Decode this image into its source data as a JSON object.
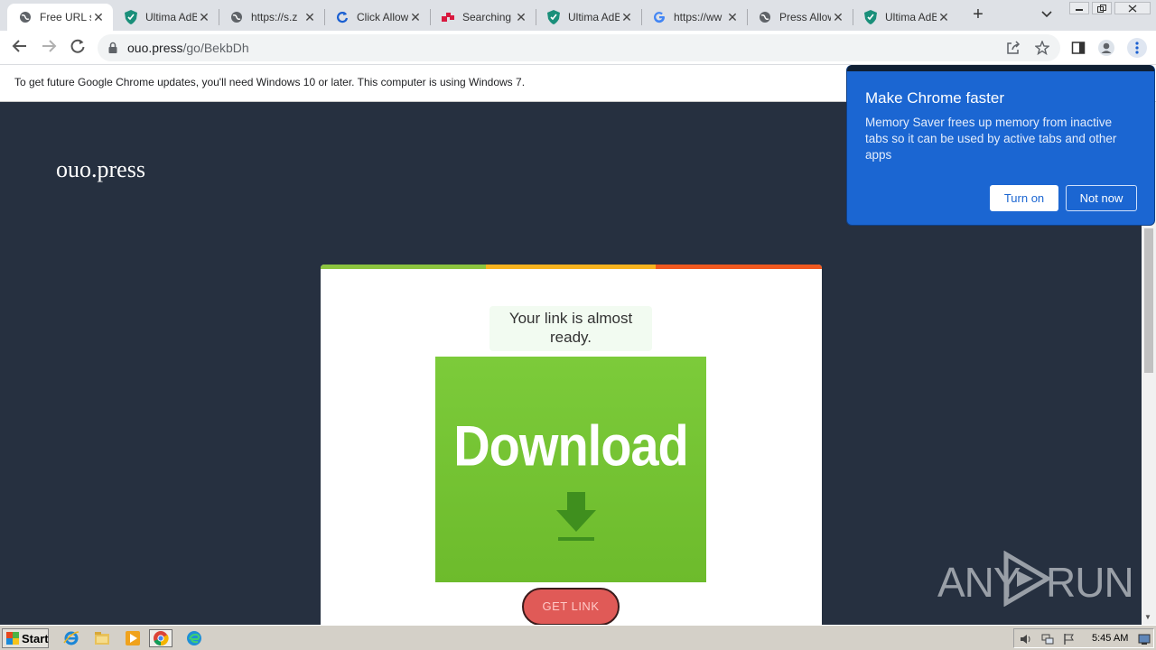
{
  "tabs": [
    {
      "title": "Free URL s",
      "icon": "globe-icon",
      "active": true
    },
    {
      "title": "Ultima AdBl",
      "icon": "shield-icon"
    },
    {
      "title": "https://s.z",
      "icon": "globe-icon"
    },
    {
      "title": "Click Allow",
      "icon": "refresh-icon"
    },
    {
      "title": "Searching f",
      "icon": "dots-icon"
    },
    {
      "title": "Ultima AdBl",
      "icon": "shield-icon"
    },
    {
      "title": "https://ww",
      "icon": "google-icon"
    },
    {
      "title": "Press Allow",
      "icon": "globe-icon"
    },
    {
      "title": "Ultima AdBl",
      "icon": "shield-icon"
    }
  ],
  "toolbar": {
    "url_host": "ouo.press",
    "url_path": "/go/BekbDh"
  },
  "infobar": {
    "message": "To get future Google Chrome updates, you'll need Windows 10 or later. This computer is using Windows 7."
  },
  "page": {
    "logo": "ouo.press",
    "ready_text": "Your link is almost ready.",
    "download_text": "Download",
    "get_link_label": "GET LINK",
    "stripe_colors": [
      "#8cc43f",
      "#f7b31e",
      "#f0581f"
    ]
  },
  "popup": {
    "title": "Make Chrome faster",
    "body": "Memory Saver frees up memory from inactive tabs so it can be used by active tabs and other apps",
    "turn_on_label": "Turn on",
    "not_now_label": "Not now"
  },
  "watermark": {
    "left": "ANY",
    "right": "RUN"
  },
  "taskbar": {
    "start_label": "Start",
    "clock": "5:45 AM"
  }
}
